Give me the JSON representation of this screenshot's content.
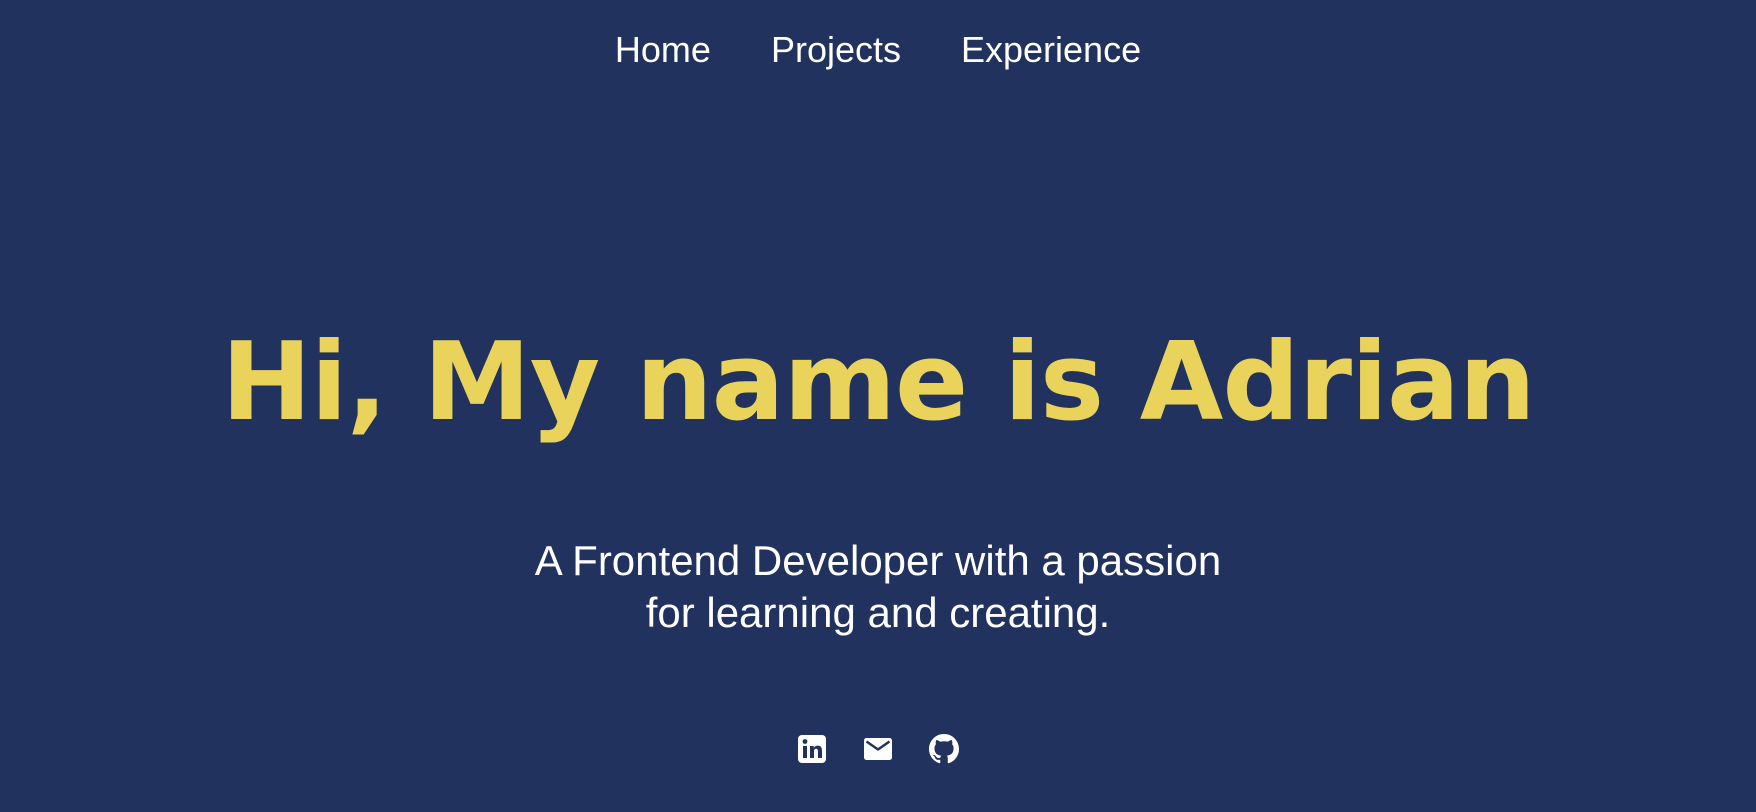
{
  "nav": {
    "items": [
      {
        "label": "Home"
      },
      {
        "label": "Projects"
      },
      {
        "label": "Experience"
      }
    ]
  },
  "hero": {
    "title": "Hi, My name is Adrian",
    "tagline_line1": "A Frontend Developer with a passion",
    "tagline_line2": "for learning and creating."
  },
  "socials": [
    {
      "icon": "linkedin-icon"
    },
    {
      "icon": "mail-icon"
    },
    {
      "icon": "github-icon"
    }
  ],
  "colors": {
    "background": "#22325e",
    "accent": "#e9d35a",
    "text": "#ffffff"
  }
}
